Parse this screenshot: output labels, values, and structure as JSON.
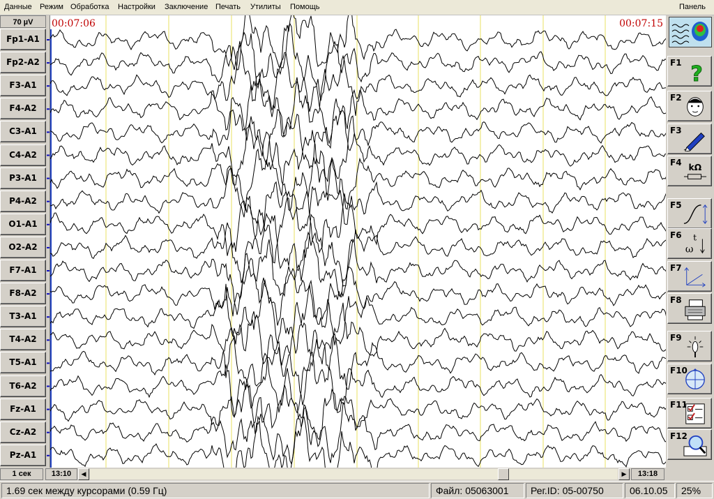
{
  "menu": {
    "items": [
      "Данные",
      "Режим",
      "Обработка",
      "Настройки",
      "Заключение",
      "Печать",
      "Утилиты",
      "Помощь"
    ],
    "panel": "Панель"
  },
  "scale_label": "70 µV",
  "channels": [
    "Fp1-A1",
    "Fp2-A2",
    "F3-A1",
    "F4-A2",
    "C3-A1",
    "C4-A2",
    "P3-A1",
    "P4-A2",
    "O1-A1",
    "O2-A2",
    "F7-A1",
    "F8-A2",
    "T3-A1",
    "T4-A2",
    "T5-A1",
    "T6-A2",
    "Fz-A1",
    "Cz-A2",
    "Pz-A1"
  ],
  "eeg": {
    "time_start": "00:07:06",
    "time_end": "00:07:15",
    "trace_color": "#000000",
    "marker_color": "#e8e060",
    "calibration_color": "#1010c0"
  },
  "function_keys": [
    {
      "key": "F1",
      "icon": "help-icon"
    },
    {
      "key": "F2",
      "icon": "patient-face-icon"
    },
    {
      "key": "F3",
      "icon": "pen-icon"
    },
    {
      "key": "F4",
      "icon": "impedance-icon",
      "text": "kΩ"
    },
    {
      "key": "F5",
      "icon": "calibration-curve-icon"
    },
    {
      "key": "F6",
      "icon": "time-frequency-icon",
      "text_t": "t",
      "text_w": "ω"
    },
    {
      "key": "F7",
      "icon": "axes-icon"
    },
    {
      "key": "F8",
      "icon": "printer-icon"
    },
    {
      "key": "F9",
      "icon": "light-stimulus-icon"
    },
    {
      "key": "F10",
      "icon": "head-map-icon"
    },
    {
      "key": "F11",
      "icon": "checklist-icon"
    },
    {
      "key": "F12",
      "icon": "magnifier-icon"
    }
  ],
  "bottom": {
    "time_scale": "1 сек",
    "left_time": "13:10",
    "right_time": "13:18",
    "scroll_position": 0.79
  },
  "status": {
    "cursor_info": "1.69 сек между курсорами (0.59 Гц)",
    "file": "Файл: 05063001",
    "reg_id": "Рег.ID: 05-00750",
    "date": "06.10.05",
    "zoom": "25%"
  }
}
